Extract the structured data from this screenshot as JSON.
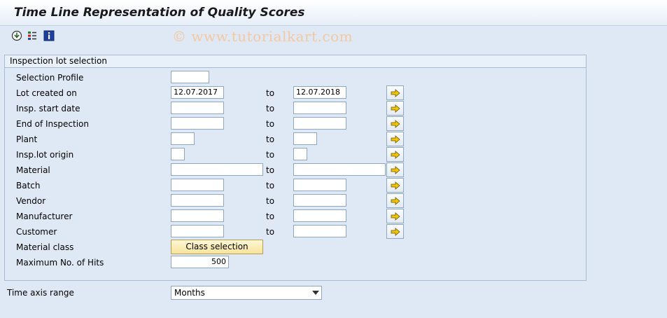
{
  "window": {
    "title": "Time Line Representation of Quality Scores"
  },
  "toolbar": {
    "icons": [
      "execute-icon",
      "selection-options-icon",
      "info-icon"
    ]
  },
  "watermark": "© www.tutorialkart.com",
  "group": {
    "title": "Inspection lot selection",
    "to_label": "to",
    "rows": [
      {
        "label": "Selection Profile"
      },
      {
        "label": "Lot created on",
        "from": "12.07.2017",
        "to": "12.07.2018"
      },
      {
        "label": "Insp. start date",
        "from": "",
        "to": ""
      },
      {
        "label": "End of Inspection",
        "from": "",
        "to": ""
      },
      {
        "label": "Plant",
        "from": "",
        "to": ""
      },
      {
        "label": "Insp.lot origin",
        "from": "",
        "to": ""
      },
      {
        "label": "Material",
        "from": "",
        "to": ""
      },
      {
        "label": "Batch",
        "from": "",
        "to": ""
      },
      {
        "label": "Vendor",
        "from": "",
        "to": ""
      },
      {
        "label": "Manufacturer",
        "from": "",
        "to": ""
      },
      {
        "label": "Customer",
        "from": "",
        "to": ""
      },
      {
        "label": "Material class",
        "button": "Class selection"
      },
      {
        "label": "Maximum No. of Hits",
        "value": "500"
      }
    ]
  },
  "time_axis": {
    "label": "Time axis range",
    "selected": "Months"
  },
  "colors": {
    "arrow": "#f0c400",
    "button": "#f7e39a",
    "background": "#dfe9f5"
  }
}
